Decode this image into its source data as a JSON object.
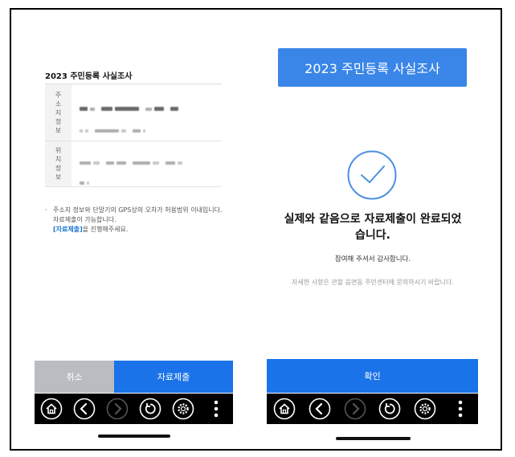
{
  "left_screen": {
    "title": "2023 주민등록 사실조사",
    "table": {
      "rows": [
        {
          "header_chars": [
            "주",
            "소",
            "지",
            "정",
            "보"
          ]
        },
        {
          "header_chars": [
            "위",
            "치",
            "정",
            "보"
          ]
        }
      ]
    },
    "note": {
      "bullet": "·",
      "line1": "주소지 정보와 단말기의 GPS상의 오차가 허용범위 이내입니다.",
      "line2": "자료제출이 가능합니다.",
      "link": "[자료제출]",
      "line3_suffix": "을 진행해주세요."
    },
    "buttons": {
      "cancel": "취소",
      "submit": "자료제출"
    }
  },
  "right_screen": {
    "banner": "2023 주민등록 사실조사",
    "message_line1": "실제와 같음으로 자료제출이 완료되었",
    "message_line2": "습니다.",
    "thanks": "참여해 주셔서 감사합니다.",
    "inquiry": "자세한 사항은 관할 읍면동 주민센터에 문의하시기 바랍니다.",
    "confirm": "확인"
  },
  "nav_icons": [
    "home-icon",
    "back-icon",
    "forward-icon",
    "refresh-icon",
    "gear-icon",
    "more-icon"
  ],
  "colors": {
    "primary": "#1a73e8",
    "banner": "#3a86e8",
    "cancel": "#b9bcc1",
    "check": "#4a90e2"
  }
}
